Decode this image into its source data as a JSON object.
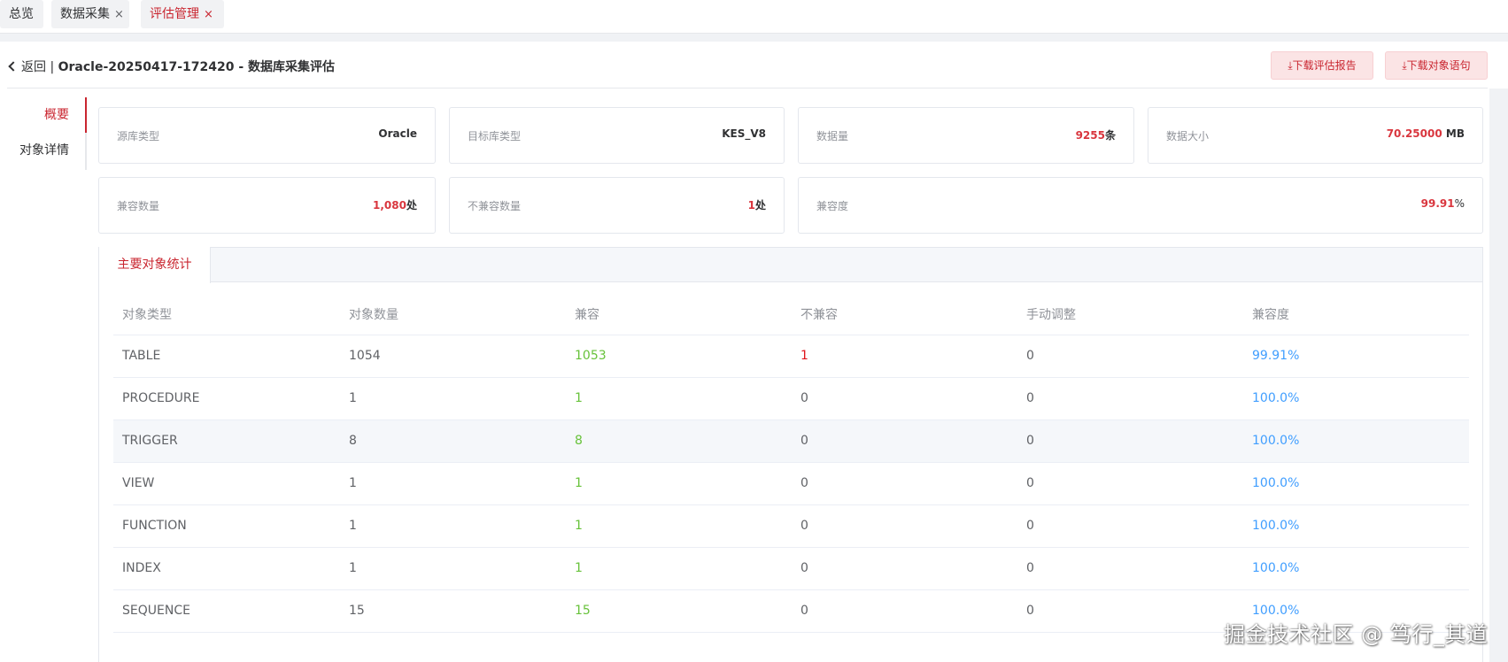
{
  "tabs": [
    {
      "label": "总览",
      "closable": false,
      "active": false
    },
    {
      "label": "数据采集",
      "closable": true,
      "active": false
    },
    {
      "label": "评估管理",
      "closable": true,
      "active": true
    }
  ],
  "close_glyph": "×",
  "header": {
    "back_label": "返回",
    "separator": " | ",
    "title": "Oracle-20250417-172420 - 数据库采集评估",
    "buttons": [
      {
        "icon": "download-icon",
        "label": "下载评估报告"
      },
      {
        "icon": "download-icon",
        "label": "下载对象语句"
      }
    ]
  },
  "sidenav": {
    "items": [
      {
        "label": "概要",
        "active": true
      },
      {
        "label": "对象详情",
        "active": false
      }
    ]
  },
  "cards": {
    "source_type": {
      "label": "源库类型",
      "value": "Oracle"
    },
    "target_type": {
      "label": "目标库类型",
      "value": "KES_V8"
    },
    "data_count": {
      "label": "数据量",
      "value": "9255",
      "unit": "条"
    },
    "data_size": {
      "label": "数据大小",
      "value": "70.25000",
      "unit": "MB"
    },
    "compatible_count": {
      "label": "兼容数量",
      "value": "1,080",
      "unit": "处"
    },
    "incompatible_count": {
      "label": "不兼容数量",
      "value": "1",
      "unit": "处"
    },
    "compatibility": {
      "label": "兼容度",
      "value": "99.91",
      "unit": "%"
    }
  },
  "panel": {
    "tab_label": "主要对象统计",
    "columns": [
      "对象类型",
      "对象数量",
      "兼容",
      "不兼容",
      "手动调整",
      "兼容度"
    ],
    "rows": [
      {
        "type": "TABLE",
        "count": "1054",
        "compatible": "1053",
        "incompatible": "1",
        "manual": "0",
        "rate": "99.91%"
      },
      {
        "type": "PROCEDURE",
        "count": "1",
        "compatible": "1",
        "incompatible": "0",
        "manual": "0",
        "rate": "100.0%"
      },
      {
        "type": "TRIGGER",
        "count": "8",
        "compatible": "8",
        "incompatible": "0",
        "manual": "0",
        "rate": "100.0%"
      },
      {
        "type": "VIEW",
        "count": "1",
        "compatible": "1",
        "incompatible": "0",
        "manual": "0",
        "rate": "100.0%"
      },
      {
        "type": "FUNCTION",
        "count": "1",
        "compatible": "1",
        "incompatible": "0",
        "manual": "0",
        "rate": "100.0%"
      },
      {
        "type": "INDEX",
        "count": "1",
        "compatible": "1",
        "incompatible": "0",
        "manual": "0",
        "rate": "100.0%"
      },
      {
        "type": "SEQUENCE",
        "count": "15",
        "compatible": "15",
        "incompatible": "0",
        "manual": "0",
        "rate": "100.0%"
      }
    ]
  },
  "watermark": "掘金技术社区 @ 笃行_其道",
  "colors": {
    "accent_red": "#c9252f",
    "value_red": "#d9363e",
    "compatible_green": "#67c23a",
    "incompatible_red": "#e0151c",
    "rate_blue": "#409eff"
  }
}
